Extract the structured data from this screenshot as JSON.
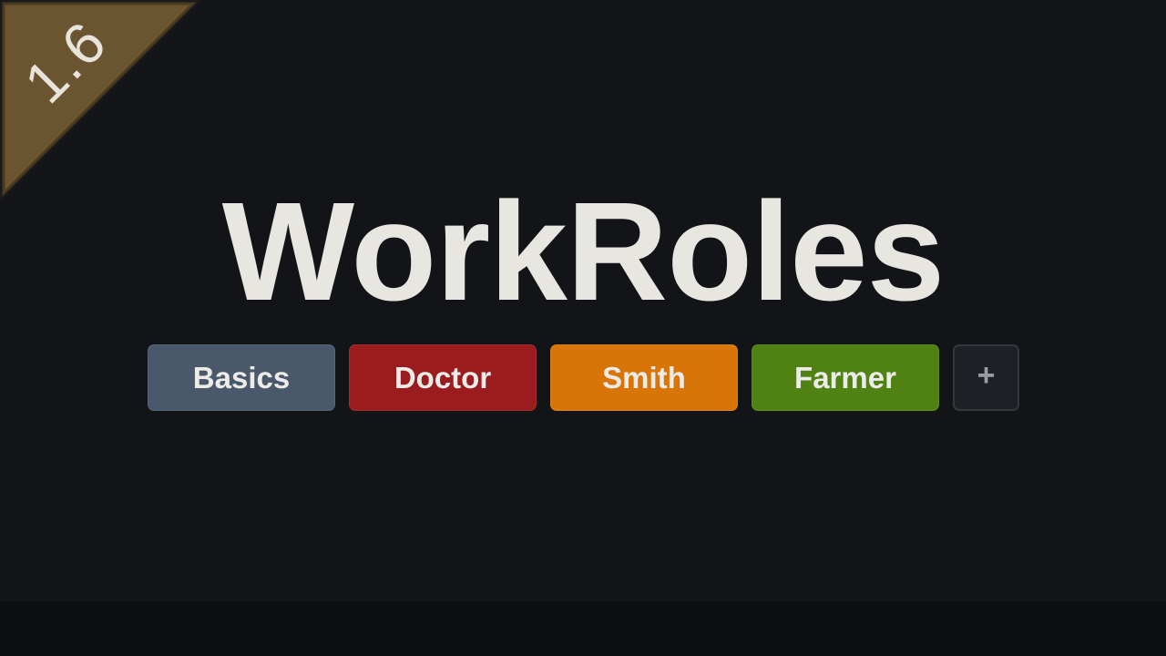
{
  "version_badge": {
    "label": "1.6",
    "color": "#6b5430"
  },
  "title": "WorkRoles",
  "roles": [
    {
      "label": "Basics",
      "color": "#4a586b"
    },
    {
      "label": "Doctor",
      "color": "#9b1c1f"
    },
    {
      "label": "Smith",
      "color": "#d97506"
    },
    {
      "label": "Farmer",
      "color": "#4f8212"
    }
  ],
  "add_button": {
    "label": "+",
    "icon": "plus-icon"
  },
  "colors": {
    "background": "#121418",
    "title_text": "#e8e6e1"
  }
}
